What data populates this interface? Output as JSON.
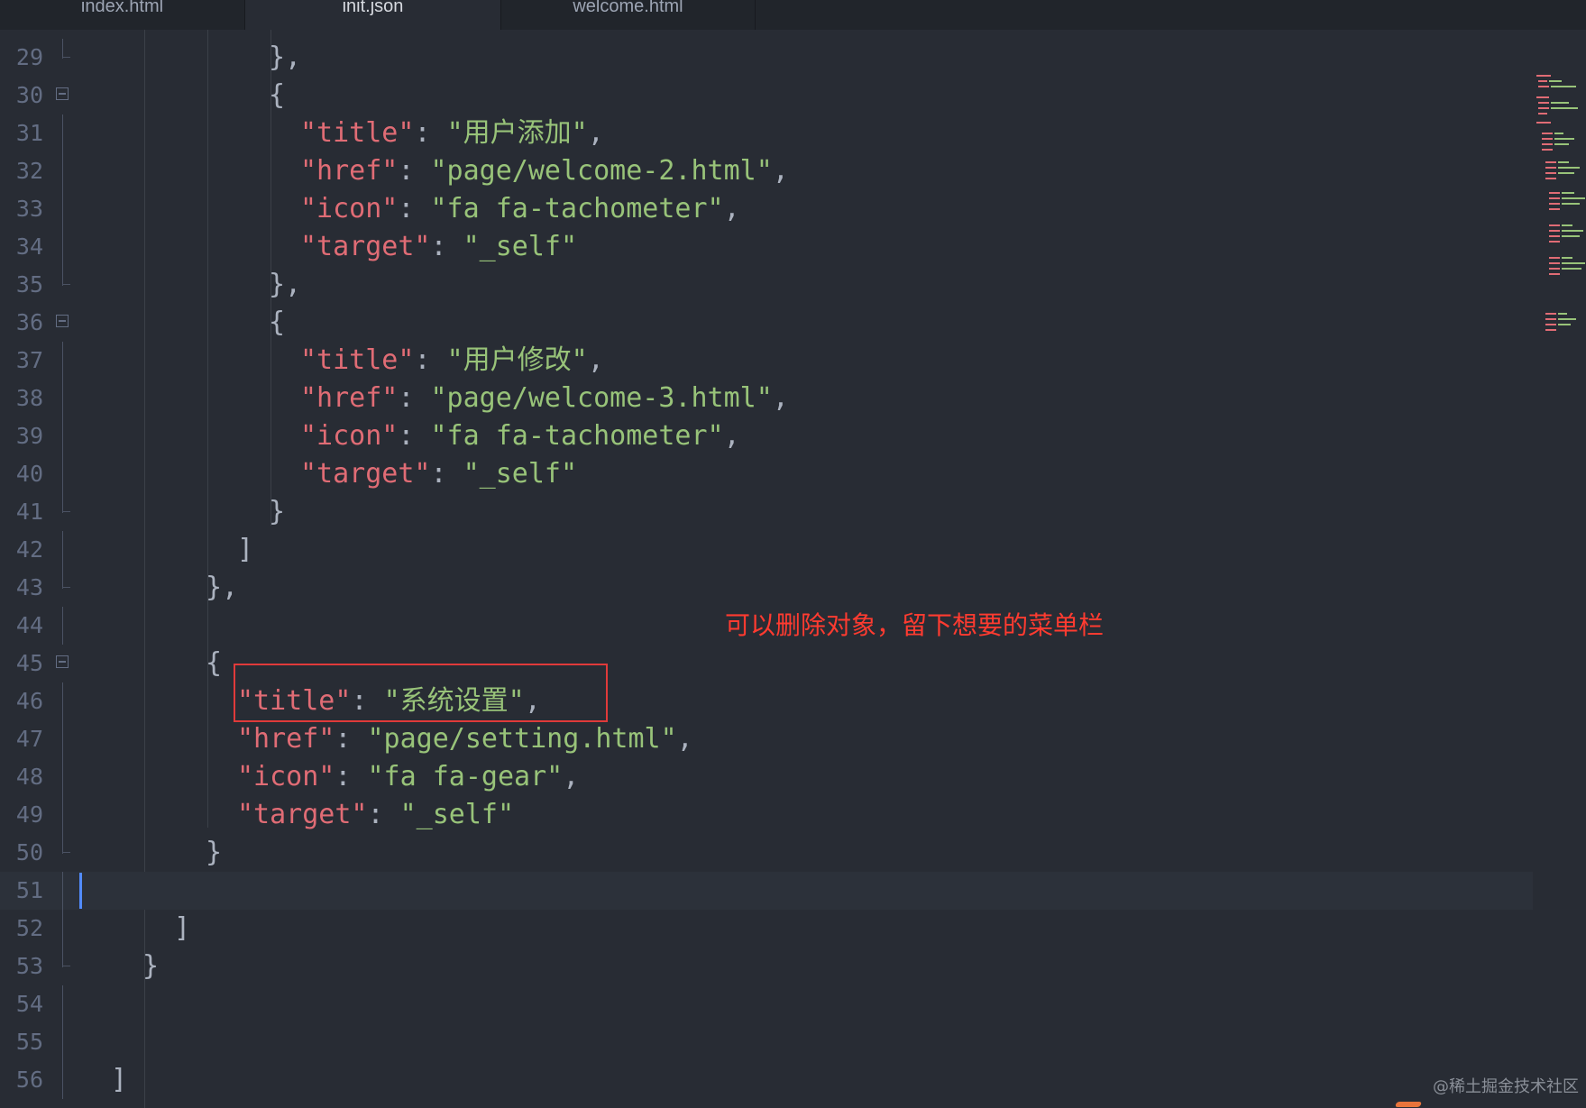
{
  "tabs": [
    {
      "label": "index.html",
      "active": false
    },
    {
      "label": "init.json",
      "active": true
    },
    {
      "label": "welcome.html",
      "active": false
    }
  ],
  "lines": [
    {
      "n": "29",
      "fold": "end"
    },
    {
      "n": "30",
      "fold": "box"
    },
    {
      "n": "31",
      "fold": "line"
    },
    {
      "n": "32",
      "fold": "line"
    },
    {
      "n": "33",
      "fold": "line"
    },
    {
      "n": "34",
      "fold": "line"
    },
    {
      "n": "35",
      "fold": "end"
    },
    {
      "n": "36",
      "fold": "box"
    },
    {
      "n": "37",
      "fold": "line"
    },
    {
      "n": "38",
      "fold": "line"
    },
    {
      "n": "39",
      "fold": "line"
    },
    {
      "n": "40",
      "fold": "line"
    },
    {
      "n": "41",
      "fold": "end"
    },
    {
      "n": "42",
      "fold": "line"
    },
    {
      "n": "43",
      "fold": "end"
    },
    {
      "n": "44",
      "fold": "line"
    },
    {
      "n": "45",
      "fold": "box"
    },
    {
      "n": "46",
      "fold": "line"
    },
    {
      "n": "47",
      "fold": "line"
    },
    {
      "n": "48",
      "fold": "line"
    },
    {
      "n": "49",
      "fold": "line"
    },
    {
      "n": "50",
      "fold": "end"
    },
    {
      "n": "51",
      "fold": "line"
    },
    {
      "n": "52",
      "fold": "line"
    },
    {
      "n": "53",
      "fold": "end"
    },
    {
      "n": "54",
      "fold": "line"
    },
    {
      "n": "55",
      "fold": "line"
    },
    {
      "n": "56",
      "fold": "line"
    }
  ],
  "code": {
    "l29": {
      "p": "},"
    },
    "l30": {
      "p": "{"
    },
    "l31": {
      "k": "\"title\"",
      "sep": ": ",
      "s": "\"用户添加\"",
      "tail": ","
    },
    "l32": {
      "k": "\"href\"",
      "sep": ": ",
      "s": "\"page/welcome-2.html\"",
      "tail": ","
    },
    "l33": {
      "k": "\"icon\"",
      "sep": ": ",
      "s": "\"fa fa-tachometer\"",
      "tail": ","
    },
    "l34": {
      "k": "\"target\"",
      "sep": ": ",
      "s": "\"_self\"",
      "tail": ""
    },
    "l35": {
      "p": "},"
    },
    "l36": {
      "p": "{"
    },
    "l37": {
      "k": "\"title\"",
      "sep": ": ",
      "s": "\"用户修改\"",
      "tail": ","
    },
    "l38": {
      "k": "\"href\"",
      "sep": ": ",
      "s": "\"page/welcome-3.html\"",
      "tail": ","
    },
    "l39": {
      "k": "\"icon\"",
      "sep": ": ",
      "s": "\"fa fa-tachometer\"",
      "tail": ","
    },
    "l40": {
      "k": "\"target\"",
      "sep": ": ",
      "s": "\"_self\"",
      "tail": ""
    },
    "l41": {
      "p": "}"
    },
    "l42": {
      "p": "]"
    },
    "l43": {
      "p": "},"
    },
    "l45": {
      "p": "{"
    },
    "l46": {
      "k": "\"title\"",
      "sep": ": ",
      "s": "\"系统设置\"",
      "tail": ","
    },
    "l47": {
      "k": "\"href\"",
      "sep": ": ",
      "s": "\"page/setting.html\"",
      "tail": ","
    },
    "l48": {
      "k": "\"icon\"",
      "sep": ": ",
      "s": "\"fa fa-gear\"",
      "tail": ","
    },
    "l49": {
      "k": "\"target\"",
      "sep": ": ",
      "s": "\"_self\"",
      "tail": ""
    },
    "l50": {
      "p": "}"
    },
    "l52": {
      "p": "]"
    },
    "l53": {
      "p": "}"
    },
    "l56": {
      "p": "]"
    }
  },
  "annotation": "可以删除对象，留下想要的菜单栏",
  "watermark": "@稀土掘金技术社区",
  "colors": {
    "background": "#282c34",
    "key": "#e06c75",
    "string": "#98c379",
    "punctuation": "#abb2bf",
    "line_number": "#636d83",
    "annotation": "#ff3b30",
    "highlight_box": "#e03a3a",
    "cursor": "#528bff"
  }
}
